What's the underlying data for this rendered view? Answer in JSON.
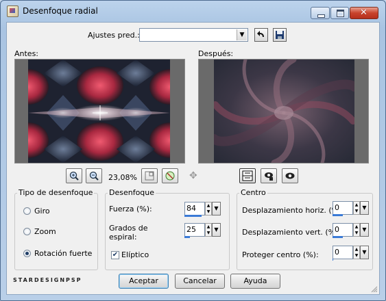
{
  "window": {
    "title": "Desenfoque radial"
  },
  "presets": {
    "label": "Ajustes pred.:",
    "value": ""
  },
  "previews": {
    "before_label": "Antes:",
    "after_label": "Después:"
  },
  "zoom": {
    "value": "23,08%"
  },
  "blur_type": {
    "title": "Tipo de desenfoque",
    "options": [
      {
        "label": "Giro",
        "selected": false
      },
      {
        "label": "Zoom",
        "selected": false
      },
      {
        "label": "Rotación fuerte",
        "selected": true
      }
    ]
  },
  "blur": {
    "title": "Desenfoque",
    "strength_label": "Fuerza (%):",
    "strength_value": "84",
    "spiral_label_line1": "Grados de",
    "spiral_label_line2": "espiral:",
    "spiral_value": "25",
    "elliptic_label": "Elíptico",
    "elliptic_checked": true
  },
  "center": {
    "title": "Centro",
    "hshift_label": "Desplazamiento horiz. (%):",
    "hshift_value": "0",
    "vshift_label": "Desplazamiento vert. (%):",
    "vshift_value": "0",
    "protect_label": "Proteger centro (%):",
    "protect_value": "0"
  },
  "buttons": {
    "ok": "Aceptar",
    "cancel": "Cancelar",
    "help": "Ayuda"
  },
  "brand": "STARDESIGNPSP",
  "colors": {
    "accent": "#3a7ad6",
    "close": "#c8432c",
    "image_red": "#c8304a",
    "image_dark": "#1c2230"
  }
}
